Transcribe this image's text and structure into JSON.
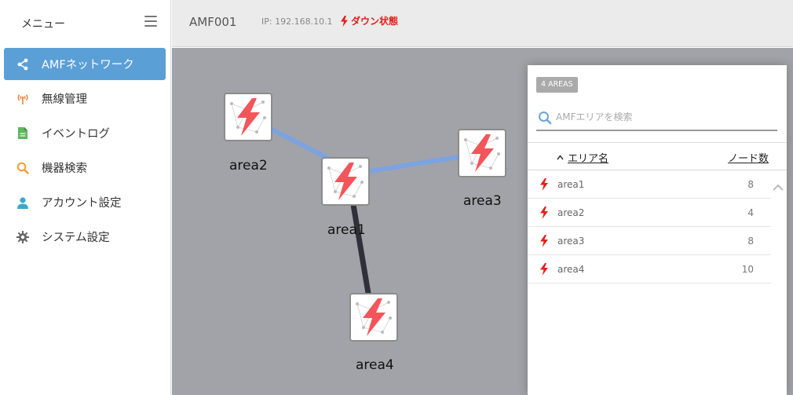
{
  "sidebar": {
    "title": "メニュー",
    "items": [
      {
        "label": "AMFネットワーク",
        "icon": "share-icon"
      },
      {
        "label": "無線管理",
        "icon": "wireless-icon"
      },
      {
        "label": "イベントログ",
        "icon": "document-icon"
      },
      {
        "label": "機器検索",
        "icon": "search-icon"
      },
      {
        "label": "アカウント設定",
        "icon": "user-icon"
      },
      {
        "label": "システム設定",
        "icon": "gear-icon"
      }
    ]
  },
  "header": {
    "node_name": "AMF001",
    "ip": "IP: 192.168.10.1",
    "status": "ダウン状態"
  },
  "map": {
    "nodes": [
      {
        "label": "area1",
        "status": "down"
      },
      {
        "label": "area2",
        "status": "down"
      },
      {
        "label": "area3",
        "status": "down"
      },
      {
        "label": "area4",
        "status": "down"
      }
    ]
  },
  "panel": {
    "badge": "4 AREAS",
    "search_placeholder": "AMFエリアを検索",
    "col_name": "エリア名",
    "col_count": "ノード数",
    "rows": [
      {
        "name": "area1",
        "count": "8"
      },
      {
        "name": "area2",
        "count": "4"
      },
      {
        "name": "area3",
        "count": "8"
      },
      {
        "name": "area4",
        "count": "10"
      }
    ]
  },
  "colors": {
    "accent": "#5b9fd7",
    "down": "#e0201b",
    "link_blue": "#7aa3e0",
    "link_dark": "#2f3038",
    "map_bg": "#a2a3a8"
  }
}
